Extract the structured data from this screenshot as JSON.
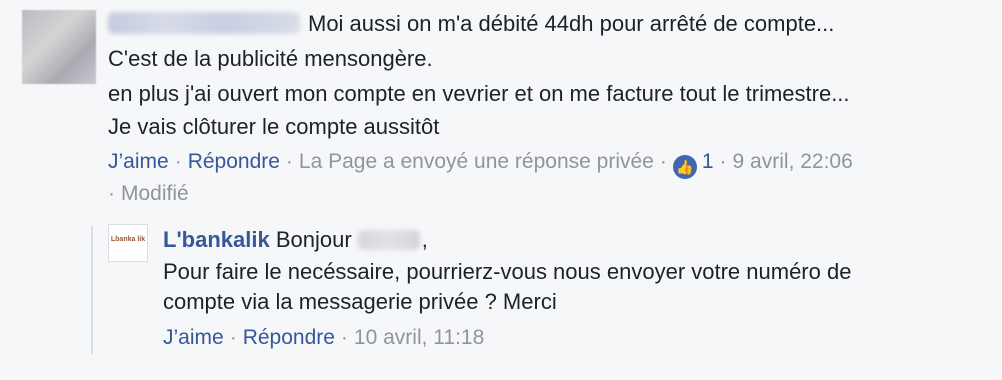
{
  "comment": {
    "text_line1": "Moi aussi on m'a débité 44dh pour arrêté de compte...",
    "text_line2": "C'est de la publicité mensongère.",
    "text_line3": "en plus j'ai ouvert mon compte en vevrier et on me facture tout le trimestre...",
    "text_line4": "Je vais clôturer le compte aussitôt",
    "actions": {
      "like": "J’aime",
      "reply": "Répondre",
      "status": "La Page a envoyé une réponse privée",
      "like_count": "1",
      "timestamp": "9 avril, 22:06",
      "edited": "Modifié"
    }
  },
  "reply": {
    "author": "L'bankalik",
    "avatar_text": "Lbanka lik",
    "greeting": "Bonjour",
    "greeting_suffix": ",",
    "text_line2": "Pour faire le necéssaire, pourrierz-vous nous envoyer votre numéro de",
    "text_line3": "compte via la messagerie privée ? Merci",
    "actions": {
      "like": "J’aime",
      "reply": "Répondre",
      "timestamp": "10 avril, 11:18"
    }
  }
}
